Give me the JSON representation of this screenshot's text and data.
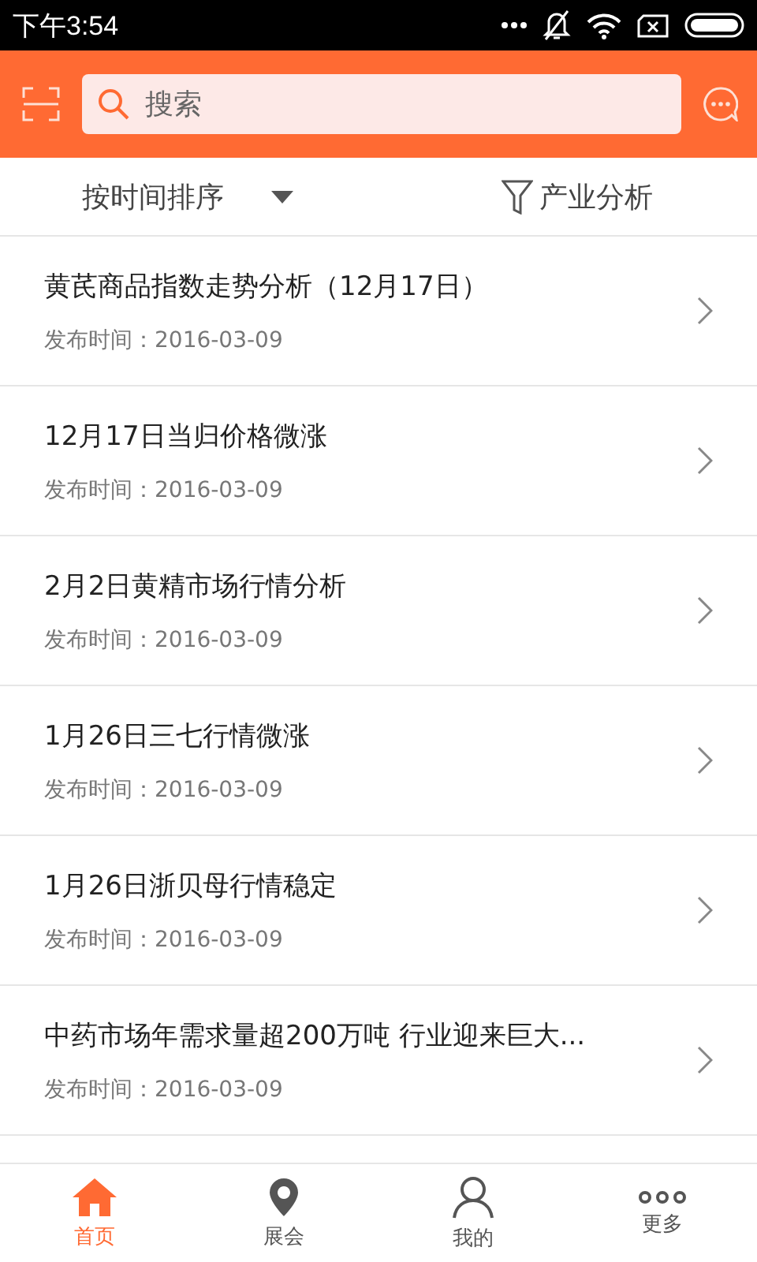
{
  "status_bar": {
    "time": "下午3:54"
  },
  "header": {
    "search": {
      "placeholder": "搜索"
    }
  },
  "filter_bar": {
    "sort": "按时间排序",
    "analysis": "产业分析"
  },
  "articles": [
    {
      "title": "黄芪商品指数走势分析（12月17日）",
      "date": "发布时间：2016-03-09"
    },
    {
      "title": "12月17日当归价格微涨",
      "date": "发布时间：2016-03-09"
    },
    {
      "title": "2月2日黄精市场行情分析",
      "date": "发布时间：2016-03-09"
    },
    {
      "title": "1月26日三七行情微涨",
      "date": "发布时间：2016-03-09"
    },
    {
      "title": "1月26日浙贝母行情稳定",
      "date": "发布时间：2016-03-09"
    },
    {
      "title": "中药市场年需求量超200万吨 行业迎来巨大...",
      "date": "发布时间：2016-03-09"
    }
  ],
  "tab_bar": [
    {
      "kind": "home",
      "label": "首页",
      "selected": true
    },
    {
      "kind": "pin",
      "label": "展会",
      "selected": false
    },
    {
      "kind": "person",
      "label": "我的",
      "selected": false
    },
    {
      "kind": "more",
      "label": "更多",
      "selected": false
    }
  ]
}
